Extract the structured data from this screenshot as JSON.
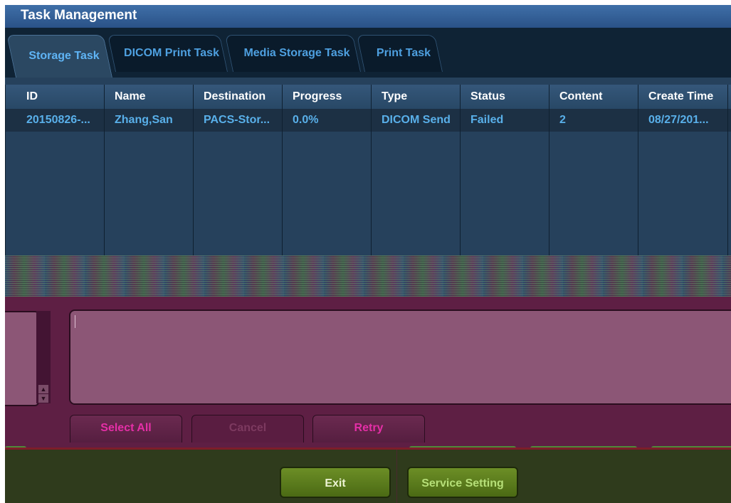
{
  "window": {
    "title": "Task Management"
  },
  "tabs": [
    {
      "label": "Storage Task",
      "active": true
    },
    {
      "label": "DICOM Print Task",
      "active": false
    },
    {
      "label": "Media Storage Task",
      "active": false
    },
    {
      "label": "Print Task",
      "active": false
    }
  ],
  "table": {
    "columns": [
      "ID",
      "Name",
      "Destination",
      "Progress",
      "Type",
      "Status",
      "Content",
      "Create Time"
    ],
    "rows": [
      {
        "id": "20150826-...",
        "name": "Zhang,San",
        "destination": "PACS-Stor...",
        "progress": "0.0%",
        "type": "DICOM Send",
        "status": "Failed",
        "content": "2",
        "create_time": "08/27/201..."
      }
    ]
  },
  "detail": {
    "text": ""
  },
  "actions": {
    "select_all": "Select All",
    "cancel": "Cancel",
    "retry": "Retry"
  },
  "footer": {
    "exit": "Exit",
    "service_setting": "Service Setting"
  },
  "colors": {
    "title_bar": "#2f5a92",
    "header_text": "#ffffff",
    "cell_text": "#59b0ea",
    "pink_button_text": "#e52fa7",
    "green_button": "#5c7d1e"
  }
}
